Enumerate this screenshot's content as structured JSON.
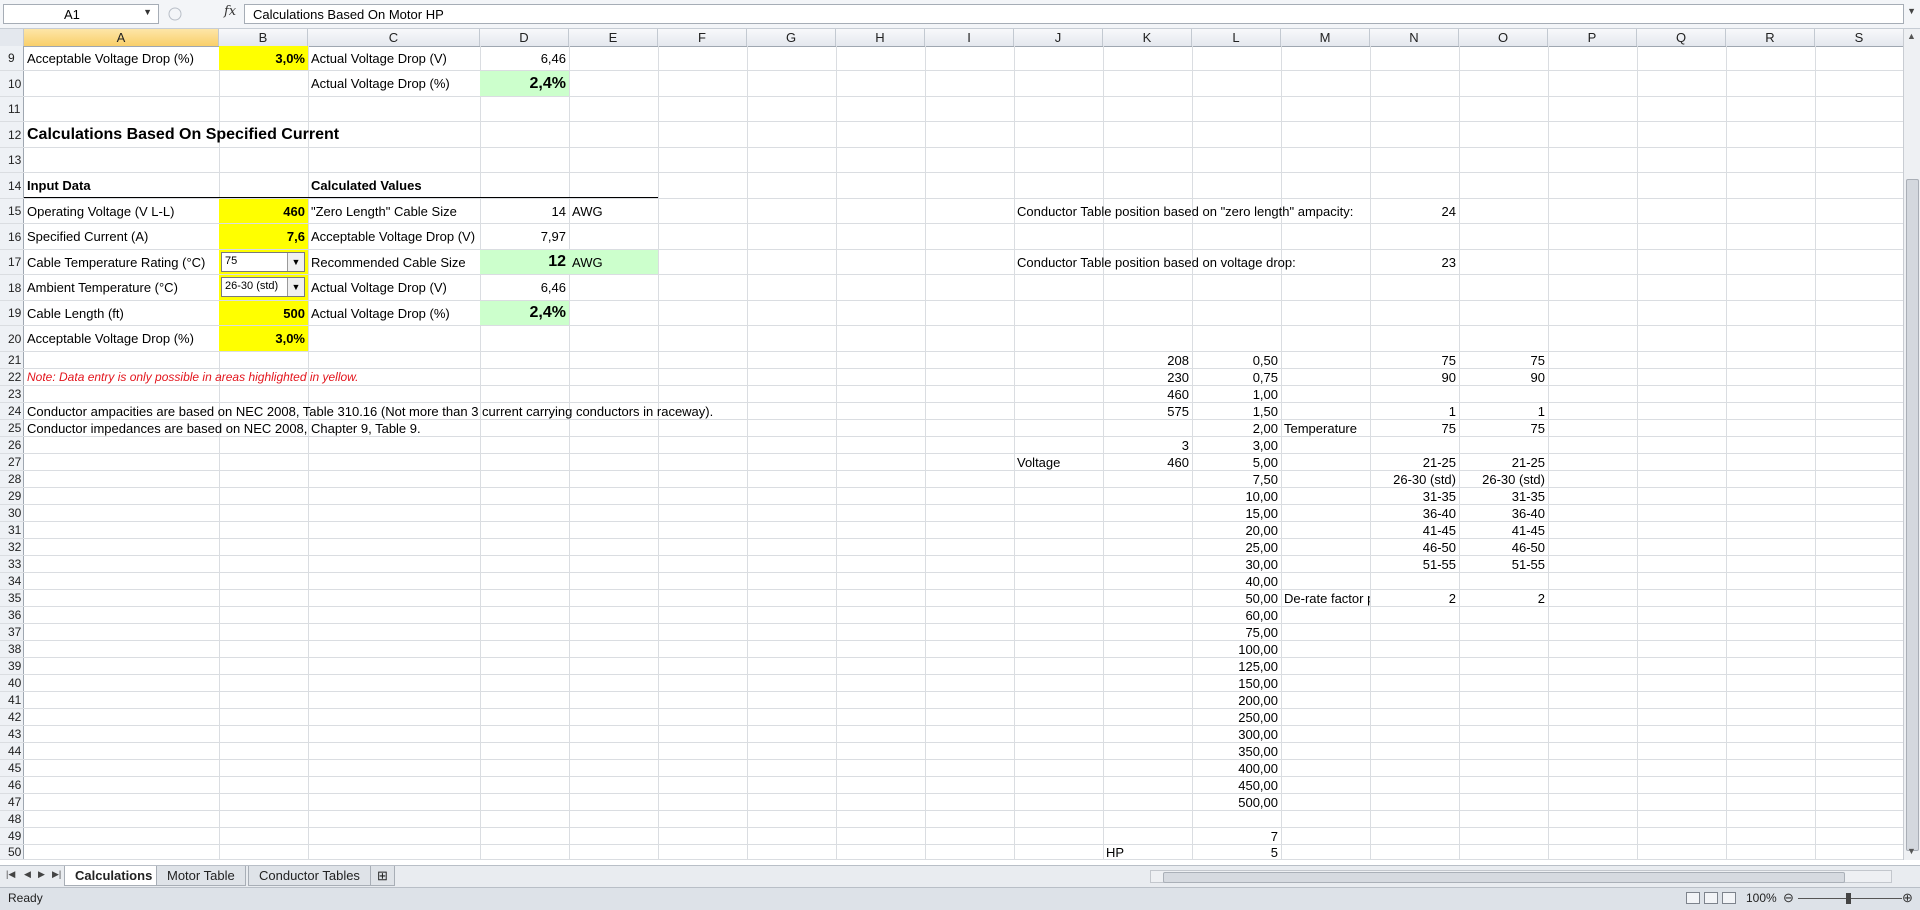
{
  "formula_bar": {
    "name_box": "A1",
    "fx_label": "fx",
    "formula": "Calculations Based On Motor HP"
  },
  "columns": [
    "A",
    "B",
    "C",
    "D",
    "E",
    "F",
    "G",
    "H",
    "I",
    "J",
    "K",
    "L",
    "M",
    "N",
    "O",
    "P",
    "Q",
    "R",
    "S"
  ],
  "rows": {
    "r9": {
      "num": "9",
      "a": "Acceptable Voltage Drop (%)",
      "b": "3,0%",
      "c": "Actual Voltage Drop (V)",
      "d": "6,46"
    },
    "r10": {
      "num": "10",
      "c": "Actual Voltage Drop (%)",
      "d": "2,4%"
    },
    "r11": {
      "num": "11"
    },
    "r12": {
      "num": "12",
      "a": "Calculations Based On Specified Current"
    },
    "r13": {
      "num": "13"
    },
    "r14": {
      "num": "14",
      "a": "Input Data",
      "c": "Calculated Values"
    },
    "r15": {
      "num": "15",
      "a": "Operating Voltage (V L-L)",
      "b": "460",
      "c": "\"Zero Length\" Cable Size",
      "d": "14",
      "e": "AWG",
      "j": "Conductor Table position based on \"zero length\" ampacity:",
      "n": "24"
    },
    "r16": {
      "num": "16",
      "a": "Specified Current (A)",
      "b": "7,6",
      "c": "Acceptable Voltage Drop (V)",
      "d": "7,97"
    },
    "r17": {
      "num": "17",
      "a": "Cable Temperature Rating (°C)",
      "b": "75",
      "c": "Recommended Cable Size",
      "d": "12",
      "e": "AWG",
      "j": "Conductor Table position based on voltage drop:",
      "n": "23"
    },
    "r18": {
      "num": "18",
      "a": "Ambient Temperature (°C)",
      "b": "26-30 (std)",
      "c": "Actual Voltage Drop (V)",
      "d": "6,46"
    },
    "r19": {
      "num": "19",
      "a": "Cable Length (ft)",
      "b": "500",
      "c": "Actual Voltage Drop (%)",
      "d": "2,4%"
    },
    "r20": {
      "num": "20",
      "a": "Acceptable Voltage Drop (%)",
      "b": "3,0%"
    },
    "r21": {
      "num": "21",
      "k": "208",
      "l": "0,50",
      "n": "75",
      "o": "75"
    },
    "r22": {
      "num": "22",
      "a": "Note:  Data entry is only possible in areas highlighted in yellow.",
      "k": "230",
      "l": "0,75",
      "n": "90",
      "o": "90"
    },
    "r23": {
      "num": "23",
      "k": "460",
      "l": "1,00"
    },
    "r24": {
      "num": "24",
      "a": "Conductor ampacities are based on NEC 2008, Table 310.16 (Not more than 3 current carrying conductors in raceway).",
      "k": "575",
      "l": "1,50",
      "n": "1",
      "o": "1"
    },
    "r25": {
      "num": "25",
      "a": "Conductor impedances are based on NEC 2008, Chapter 9, Table 9.",
      "l": "2,00",
      "m": "Temperature",
      "n": "75",
      "o": "75"
    },
    "r26": {
      "num": "26",
      "k": "3",
      "l": "3,00"
    },
    "r27": {
      "num": "27",
      "j": "Voltage",
      "k": "460",
      "l": "5,00",
      "n": "21-25",
      "o": "21-25"
    },
    "r28": {
      "num": "28",
      "l": "7,50",
      "n": "26-30 (std)",
      "o": "26-30 (std)"
    },
    "r29": {
      "num": "29",
      "l": "10,00",
      "n": "31-35",
      "o": "31-35"
    },
    "r30": {
      "num": "30",
      "l": "15,00",
      "n": "36-40",
      "o": "36-40"
    },
    "r31": {
      "num": "31",
      "l": "20,00",
      "n": "41-45",
      "o": "41-45"
    },
    "r32": {
      "num": "32",
      "l": "25,00",
      "n": "46-50",
      "o": "46-50"
    },
    "r33": {
      "num": "33",
      "l": "30,00",
      "n": "51-55",
      "o": "51-55"
    },
    "r34": {
      "num": "34",
      "l": "40,00"
    },
    "r35": {
      "num": "35",
      "l": "50,00",
      "m": "De-rate factor p",
      "n": "2",
      "o": "2"
    },
    "r36": {
      "num": "36",
      "l": "60,00"
    },
    "r37": {
      "num": "37",
      "l": "75,00"
    },
    "r38": {
      "num": "38",
      "l": "100,00"
    },
    "r39": {
      "num": "39",
      "l": "125,00"
    },
    "r40": {
      "num": "40",
      "l": "150,00"
    },
    "r41": {
      "num": "41",
      "l": "200,00"
    },
    "r42": {
      "num": "42",
      "l": "250,00"
    },
    "r43": {
      "num": "43",
      "l": "300,00"
    },
    "r44": {
      "num": "44",
      "l": "350,00"
    },
    "r45": {
      "num": "45",
      "l": "400,00"
    },
    "r46": {
      "num": "46",
      "l": "450,00"
    },
    "r47": {
      "num": "47",
      "l": "500,00"
    },
    "r48": {
      "num": "48"
    },
    "r49": {
      "num": "49",
      "l": "7"
    },
    "r50": {
      "num": "50",
      "k": "HP",
      "l": "5"
    }
  },
  "sheet_tabs": [
    "Calculations",
    "Motor Table",
    "Conductor Tables"
  ],
  "status": {
    "ready": "Ready",
    "zoom": "100%"
  },
  "colors": {
    "input_yellow": "#ffff00",
    "result_green": "#ccffcc",
    "note_red": "#e3151d"
  }
}
